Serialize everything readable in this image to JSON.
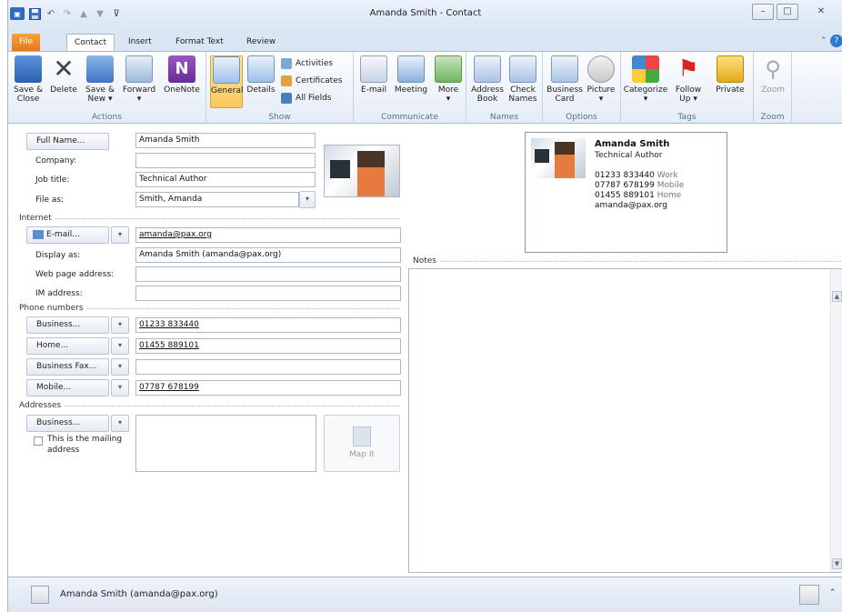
{
  "window": {
    "title": "Amanda Smith - Contact"
  },
  "tabs": [
    {
      "label": "File"
    },
    {
      "label": "Contact"
    },
    {
      "label": "Insert"
    },
    {
      "label": "Format Text"
    },
    {
      "label": "Review"
    }
  ],
  "ribbon": {
    "actions": {
      "group_label": "Actions",
      "save_close_1": "Save &",
      "save_close_2": "Close",
      "delete": "Delete",
      "save_new_1": "Save &",
      "save_new_2": "New",
      "forward": "Forward",
      "onenote": "OneNote"
    },
    "show": {
      "group_label": "Show",
      "general": "General",
      "details": "Details",
      "activities": "Activities",
      "certificates": "Certificates",
      "all_fields": "All Fields"
    },
    "communicate": {
      "group_label": "Communicate",
      "email": "E-mail",
      "meeting": "Meeting",
      "more": "More"
    },
    "names": {
      "group_label": "Names",
      "address_1": "Address",
      "address_2": "Book",
      "check_1": "Check",
      "check_2": "Names"
    },
    "options": {
      "group_label": "Options",
      "business_1": "Business",
      "business_2": "Card",
      "picture": "Picture"
    },
    "tags": {
      "group_label": "Tags",
      "categorize": "Categorize",
      "follow_1": "Follow",
      "follow_2": "Up",
      "private": "Private"
    },
    "zoom": {
      "group_label": "Zoom",
      "zoom": "Zoom"
    }
  },
  "form": {
    "full_name_button": "Full Name...",
    "full_name": "Amanda Smith",
    "company_label": "Company:",
    "company": "",
    "job_title_label": "Job title:",
    "job_title": "Technical Author",
    "file_as_label": "File as:",
    "file_as": "Smith, Amanda",
    "internet_section": "Internet",
    "email_button": "E-mail...",
    "email": "amanda@pax.org",
    "display_as_label": "Display as:",
    "display_as": "Amanda Smith (amanda@pax.org)",
    "web_page_label": "Web page address:",
    "web_page": "",
    "im_label": "IM address:",
    "im": "",
    "phone_section": "Phone numbers",
    "phones": [
      {
        "type": "Business...",
        "value": "01233 833440"
      },
      {
        "type": "Home...",
        "value": "01455 889101"
      },
      {
        "type": "Business Fax...",
        "value": ""
      },
      {
        "type": "Mobile...",
        "value": "07787 678199"
      }
    ],
    "addresses_section": "Addresses",
    "address_type": "Business...",
    "address": "",
    "mailing_checkbox_1": "This is the mailing",
    "mailing_checkbox_2": "address",
    "mailing_checked": false,
    "map_it": "Map It",
    "notes_label": "Notes"
  },
  "card": {
    "name": "Amanda Smith",
    "title": "Technical Author",
    "work_phone": "01233 833440",
    "work_label": "Work",
    "mobile_phone": "07787 678199",
    "mobile_label": "Mobile",
    "home_phone": "01455 889101",
    "home_label": "Home",
    "email": "amanda@pax.org"
  },
  "status": {
    "person": "Amanda Smith (amanda@pax.org)"
  },
  "colors": {
    "file_tab": "#e6761e",
    "selected": "#f8c85a",
    "frame": "#dbe6f4"
  }
}
